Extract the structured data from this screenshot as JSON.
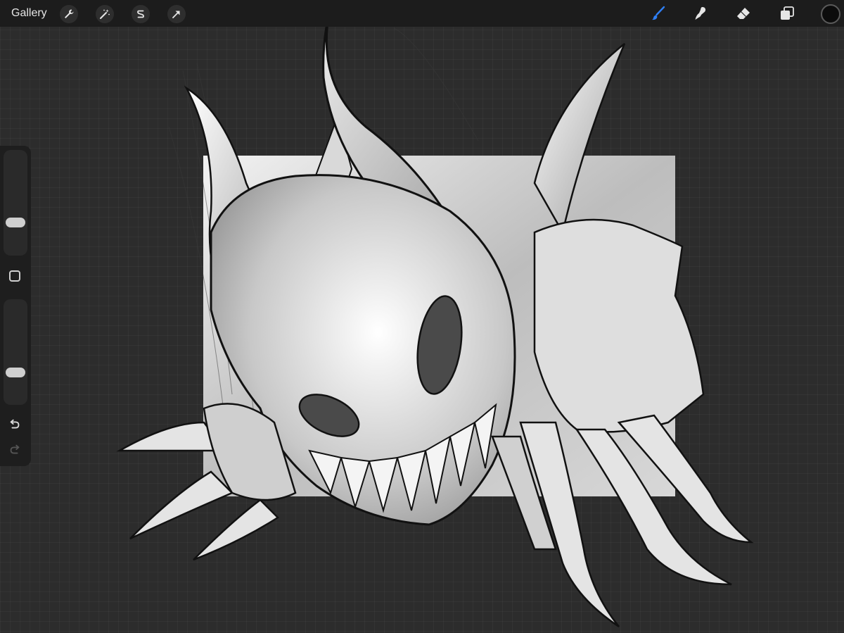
{
  "toolbar": {
    "gallery_label": "Gallery",
    "left_tools": [
      {
        "icon": "wrench-icon",
        "name": "actions"
      },
      {
        "icon": "magic-wand-icon",
        "name": "adjustments"
      },
      {
        "icon": "selection-s-icon",
        "name": "selection"
      },
      {
        "icon": "arrow-cursor-icon",
        "name": "transform"
      }
    ],
    "right_tools": [
      {
        "icon": "brush-icon",
        "name": "paint",
        "active": true
      },
      {
        "icon": "smudge-icon",
        "name": "smudge",
        "active": false
      },
      {
        "icon": "eraser-icon",
        "name": "erase",
        "active": false
      },
      {
        "icon": "layers-icon",
        "name": "layers",
        "active": false
      }
    ],
    "current_color": "#0c0c0c"
  },
  "sidebar": {
    "brush_size_icon": "slider-thumb",
    "opacity_icon": "slider-thumb",
    "modify_icon": "square-outline-icon",
    "undo_icon": "undo-icon",
    "redo_icon": "redo-icon"
  },
  "colors": {
    "accent_active": "#2f7ff5",
    "toolbar_bg": "#1c1c1c",
    "canvas_bg": "#2c2c2c"
  }
}
